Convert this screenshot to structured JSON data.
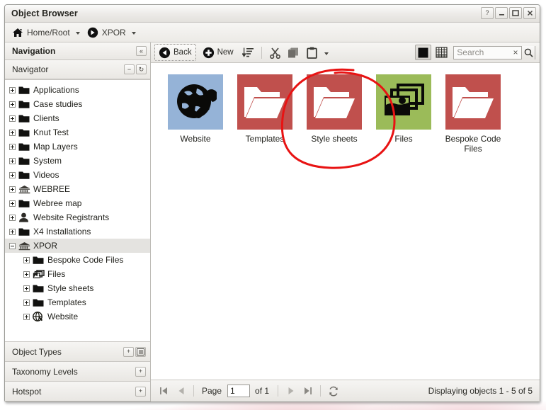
{
  "window": {
    "title": "Object Browser",
    "buttons": [
      {
        "name": "help-button",
        "glyph": "?"
      },
      {
        "name": "minimize-button",
        "glyph": "minimize-icon"
      },
      {
        "name": "maximize-button",
        "glyph": "maximize-icon"
      },
      {
        "name": "close-button",
        "glyph": "close-icon"
      }
    ]
  },
  "breadcrumb": {
    "items": [
      {
        "label": "Home/Root",
        "icon": "home-icon"
      },
      {
        "label": "XPOR",
        "icon": "arrow-right-circle-icon"
      }
    ]
  },
  "navigation": {
    "header_title": "Navigation",
    "collapse_label": "«",
    "panel_title": "Navigator",
    "panel_minimize_label": "−",
    "panel_refresh_label": "↻",
    "tree": [
      {
        "label": "Applications",
        "icon": "folder-icon",
        "expanded": false,
        "level": 0,
        "selected": false
      },
      {
        "label": "Case studies",
        "icon": "folder-icon",
        "expanded": false,
        "level": 0,
        "selected": false
      },
      {
        "label": "Clients",
        "icon": "folder-icon",
        "expanded": false,
        "level": 0,
        "selected": false
      },
      {
        "label": "Knut Test",
        "icon": "folder-icon",
        "expanded": false,
        "level": 0,
        "selected": false
      },
      {
        "label": "Map Layers",
        "icon": "folder-icon",
        "expanded": false,
        "level": 0,
        "selected": false
      },
      {
        "label": "System",
        "icon": "folder-icon",
        "expanded": false,
        "level": 0,
        "selected": false
      },
      {
        "label": "Videos",
        "icon": "folder-icon",
        "expanded": false,
        "level": 0,
        "selected": false
      },
      {
        "label": "WEBREE",
        "icon": "website-bank-icon",
        "expanded": false,
        "level": 0,
        "selected": false
      },
      {
        "label": "Webree map",
        "icon": "folder-icon",
        "expanded": false,
        "level": 0,
        "selected": false
      },
      {
        "label": "Website Registrants",
        "icon": "user-icon",
        "expanded": false,
        "level": 0,
        "selected": false
      },
      {
        "label": "X4 Installations",
        "icon": "folder-icon",
        "expanded": false,
        "level": 0,
        "selected": false
      },
      {
        "label": "XPOR",
        "icon": "website-bank-icon",
        "expanded": true,
        "level": 0,
        "selected": true
      },
      {
        "label": "Bespoke Code Files",
        "icon": "folder-icon",
        "expanded": false,
        "level": 1,
        "selected": false
      },
      {
        "label": "Files",
        "icon": "images-icon",
        "expanded": false,
        "level": 1,
        "selected": false
      },
      {
        "label": "Style sheets",
        "icon": "folder-icon",
        "expanded": false,
        "level": 1,
        "selected": false
      },
      {
        "label": "Templates",
        "icon": "folder-icon",
        "expanded": false,
        "level": 1,
        "selected": false
      },
      {
        "label": "Website",
        "icon": "globe-icon",
        "expanded": false,
        "level": 1,
        "selected": false
      }
    ],
    "sections": [
      {
        "title": "Object Types",
        "buttons": [
          "plus-icon",
          "tree-list-icon"
        ]
      },
      {
        "title": "Taxonomy Levels",
        "buttons": [
          "plus-icon"
        ]
      },
      {
        "title": "Hotspot",
        "buttons": [
          "plus-icon"
        ]
      }
    ]
  },
  "toolbar": {
    "back_label": "Back",
    "back_icon": "arrow-left-circle-icon",
    "new_label": "New",
    "new_icon": "plus-circle-icon",
    "sort_icon": "sort-descending-icon",
    "cut_icon": "scissors-icon",
    "copy_icon": "copy-icon",
    "paste_icon": "clipboard-icon",
    "paste_caret": "chevron-down-icon",
    "thumbnail_view_icon": "thumbnail-view-icon",
    "list_view_icon": "grid-view-icon",
    "search_placeholder": "Search",
    "search_value": "",
    "search_clear_label": "×",
    "search_submit_icon": "search-icon"
  },
  "items": [
    {
      "label": "Bespoke Code Files",
      "icon": "folder-open-icon",
      "color": "#c0504d",
      "highlighted": false
    },
    {
      "label": "Files",
      "icon": "images-icon",
      "color": "#9bbb59",
      "highlighted": false
    },
    {
      "label": "Style sheets",
      "icon": "folder-open-icon",
      "color": "#c0504d",
      "highlighted": false
    },
    {
      "label": "Templates",
      "icon": "folder-open-icon",
      "color": "#c0504d",
      "highlighted": true
    },
    {
      "label": "Website",
      "icon": "globe-wrench-icon",
      "color": "#95b3d7",
      "highlighted": false
    }
  ],
  "annotation": {
    "shape": "ellipse",
    "color": "#e81313",
    "target": "Templates"
  },
  "statusbar": {
    "first_icon": "first-page-icon",
    "prev_icon": "prev-page-icon",
    "page_label": "Page",
    "page_value": "1",
    "of_label": "of 1",
    "next_icon": "next-page-icon",
    "last_icon": "last-page-icon",
    "refresh_icon": "refresh-icon",
    "display_text": "Displaying objects 1 - 5 of 5"
  }
}
